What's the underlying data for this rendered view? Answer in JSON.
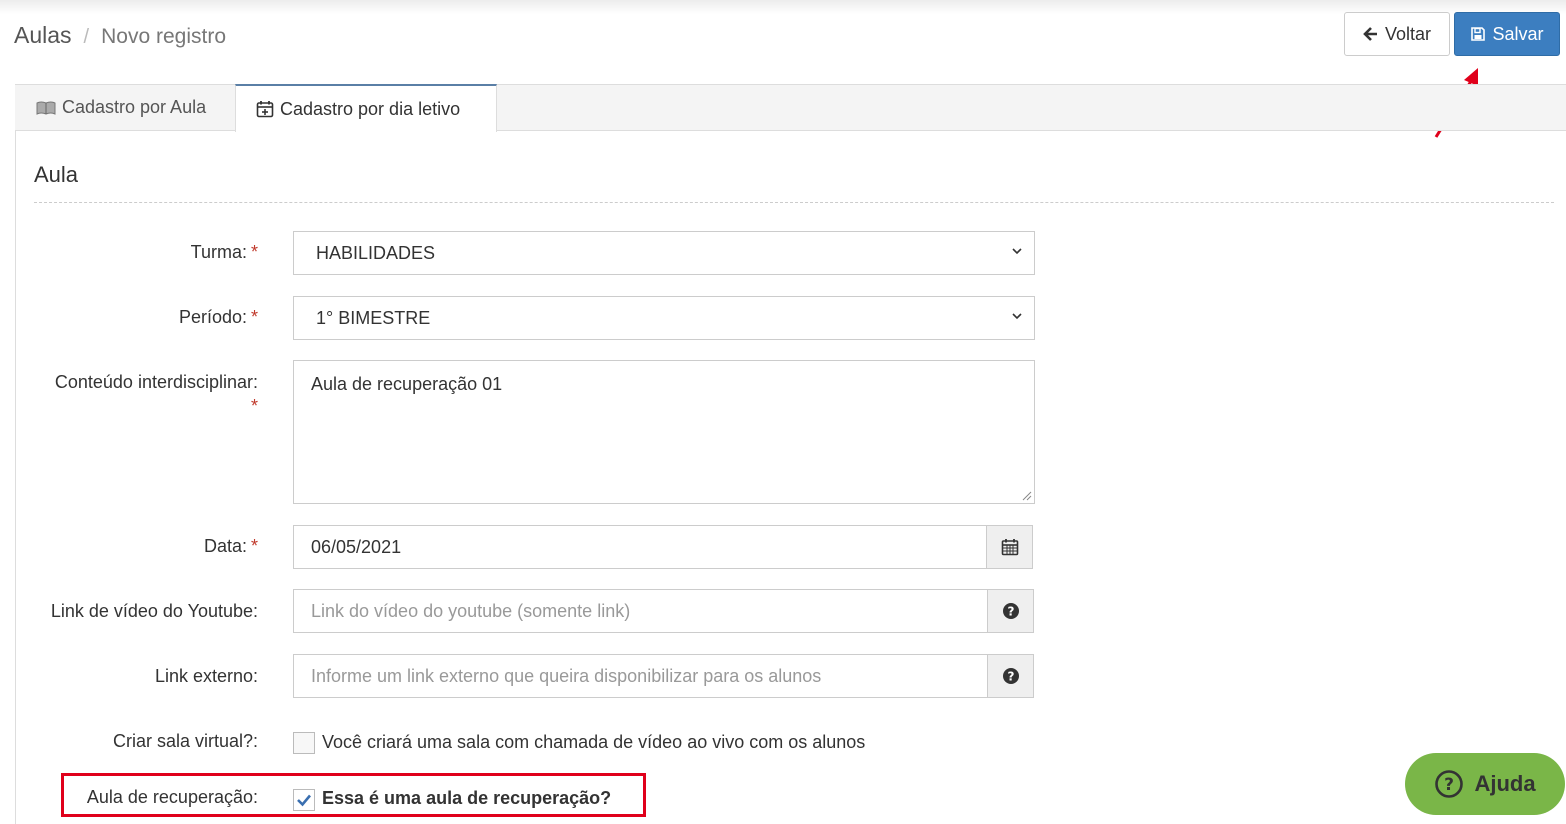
{
  "breadcrumb": {
    "root": "Aulas",
    "separator": "/",
    "current": "Novo registro"
  },
  "toolbar": {
    "back_label": "Voltar",
    "save_label": "Salvar"
  },
  "tabs": [
    {
      "label": "Cadastro por Aula",
      "icon": "book-icon",
      "active": false
    },
    {
      "label": "Cadastro por dia letivo",
      "icon": "calendar-plus-icon",
      "active": true
    }
  ],
  "section": {
    "title": "Aula"
  },
  "form": {
    "turma": {
      "label": "Turma:",
      "required": "*",
      "value": "HABILIDADES"
    },
    "periodo": {
      "label": "Período:",
      "required": "*",
      "value": "1° BIMESTRE"
    },
    "conteudo": {
      "label": "Conteúdo interdisciplinar:",
      "required": "*",
      "value": "Aula de recuperação 01"
    },
    "data": {
      "label": "Data:",
      "required": "*",
      "value": "06/05/2021"
    },
    "youtube": {
      "label": "Link de vídeo do Youtube:",
      "placeholder": "Link do vídeo do youtube (somente link)"
    },
    "link_externo": {
      "label": "Link externo:",
      "placeholder": "Informe um link externo que queira disponibilizar para os alunos"
    },
    "sala_virtual": {
      "label": "Criar sala virtual?:",
      "checkbox_label": "Você criará uma sala com chamada de vídeo ao vivo com os alunos",
      "checked": false
    },
    "recuperacao": {
      "label": "Aula de recuperação:",
      "checkbox_label": "Essa é uma aula de recuperação?",
      "checked": true
    }
  },
  "help": {
    "label": "Ajuda"
  },
  "colors": {
    "primary": "#3c7ec0",
    "required": "#c0392b",
    "highlight": "#e0001b",
    "help": "#7ab648",
    "tab_active_border": "#5a7fa6"
  }
}
